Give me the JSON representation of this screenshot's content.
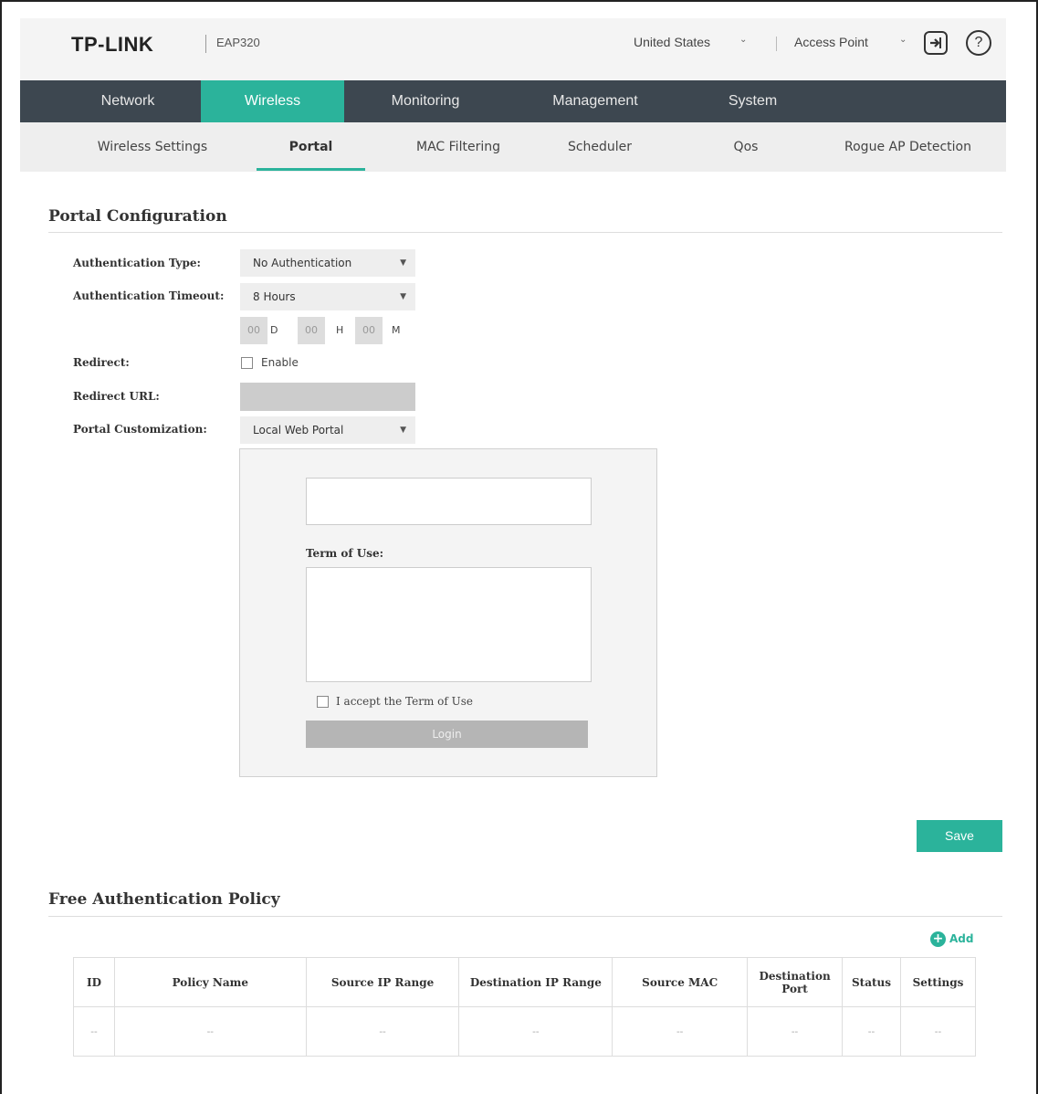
{
  "header": {
    "brand": "TP-LINK",
    "model": "EAP320",
    "region": "United States",
    "mode": "Access Point"
  },
  "main_nav": {
    "items": [
      "Network",
      "Wireless",
      "Monitoring",
      "Management",
      "System"
    ],
    "active": "Wireless"
  },
  "sub_nav": {
    "items": [
      "Wireless Settings",
      "Portal",
      "MAC Filtering",
      "Scheduler",
      "Qos",
      "Rogue AP Detection"
    ],
    "active": "Portal"
  },
  "portal_config": {
    "title": "Portal Configuration",
    "auth_type_label": "Authentication Type:",
    "auth_type_value": "No Authentication",
    "auth_timeout_label": "Authentication Timeout:",
    "auth_timeout_value": "8 Hours",
    "timeout_days": "00",
    "timeout_days_unit": "D",
    "timeout_hours": "00",
    "timeout_hours_unit": "H",
    "timeout_minutes": "00",
    "timeout_minutes_unit": "M",
    "redirect_label": "Redirect:",
    "redirect_enable_label": "Enable",
    "redirect_url_label": "Redirect URL:",
    "portal_custom_label": "Portal Customization:",
    "portal_custom_value": "Local Web Portal",
    "preview": {
      "term_of_use_label": "Term of Use:",
      "accept_label": "I accept the Term of Use",
      "login_label": "Login"
    },
    "save_label": "Save"
  },
  "free_auth_policy": {
    "title": "Free Authentication Policy",
    "add_label": "Add",
    "columns": [
      "ID",
      "Policy Name",
      "Source IP Range",
      "Destination IP Range",
      "Source MAC",
      "Destination Port",
      "Status",
      "Settings"
    ],
    "rows": [
      [
        "--",
        "--",
        "--",
        "--",
        "--",
        "--",
        "--",
        "--"
      ]
    ]
  },
  "colors": {
    "accent": "#2bb39b",
    "nav_bg": "#3d4750"
  }
}
